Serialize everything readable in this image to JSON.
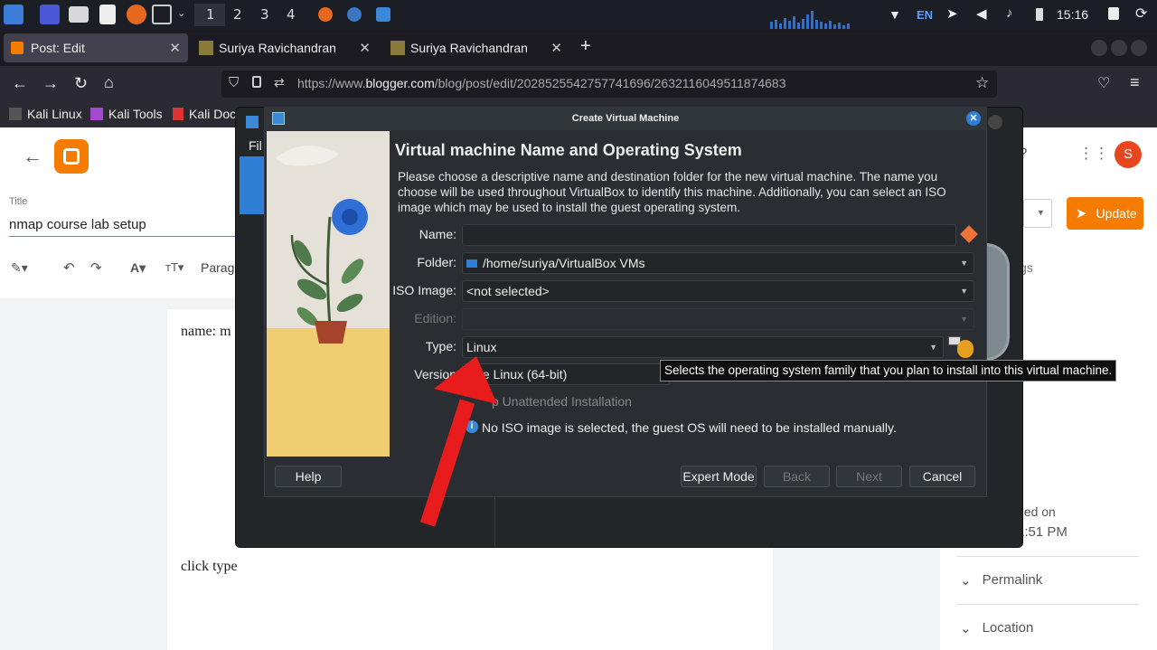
{
  "taskbar": {
    "workspaces": [
      "1",
      "2",
      "3",
      "4"
    ],
    "lang": "EN",
    "clock": "15:16"
  },
  "tabs": [
    {
      "label": "Post: Edit"
    },
    {
      "label": "Suriya Ravichandran"
    },
    {
      "label": "Suriya Ravichandran"
    }
  ],
  "new_tab": "+",
  "url": {
    "prefix": "https://www.",
    "domain": "blogger.com",
    "path": "/blog/post/edit/2028525542757741696/2632116049511874683"
  },
  "bookmarks": [
    "Kali Linux",
    "Kali Tools",
    "Kali Docs"
  ],
  "blogger": {
    "title_label": "Title",
    "title_value": "nmap course lab setup",
    "paragraph_label": "Paragr",
    "body_line1": "name: m",
    "body_line2": "click type",
    "update_label": "Update",
    "avatar_letter": "S",
    "sidebar_labels": "gs",
    "published_label": "ned on",
    "published_time": "1:51 PM",
    "permalink": "Permalink",
    "location": "Location"
  },
  "vbox_menu_partial": "Fil",
  "dialog": {
    "window_title": "Create Virtual Machine",
    "heading": "Virtual machine Name and Operating System",
    "description": "Please choose a descriptive name and destination folder for the new virtual machine. The name you choose will be used throughout VirtualBox to identify this machine. Additionally, you can select an ISO image which may be used to install the guest operating system.",
    "labels": {
      "name": "Name:",
      "folder": "Folder:",
      "iso": "ISO Image:",
      "edition": "Edition:",
      "type": "Type:",
      "version": "Version"
    },
    "values": {
      "name": "",
      "folder": "/home/suriya/VirtualBox VMs",
      "iso": "<not selected>",
      "edition": "",
      "type": "Linux",
      "version": "acle Linux (64-bit)"
    },
    "unattended": "p Unattended Installation",
    "info": "No ISO image is selected, the guest OS will need to be installed manually.",
    "tooltip": "Selects the operating system family that you plan to install into this virtual machine.",
    "buttons": {
      "help": "Help",
      "expert": "Expert Mode",
      "back": "Back",
      "next": "Next",
      "cancel": "Cancel"
    }
  },
  "colors": {
    "accent_orange": "#f57c00",
    "arrow_red": "#e81c1c",
    "dialog_bg": "#2a2e32"
  }
}
